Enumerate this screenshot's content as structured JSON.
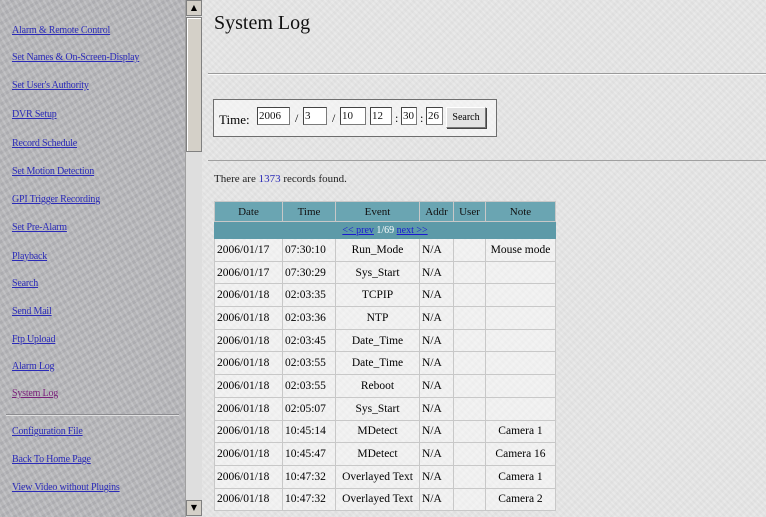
{
  "sidebar": {
    "items": [
      {
        "label": "Alarm & Remote Control",
        "visited": false
      },
      {
        "label": "Set Names & On-Screen-Display",
        "visited": false
      },
      {
        "label": "Set User's Authority",
        "visited": false
      },
      {
        "label": "DVR Setup",
        "visited": false
      },
      {
        "label": "Record Schedule",
        "visited": false
      },
      {
        "label": "Set Motion Detection",
        "visited": false
      },
      {
        "label": "GPI Trigger Recording",
        "visited": false
      },
      {
        "label": "Set Pre-Alarm",
        "visited": false
      },
      {
        "label": "Playback",
        "visited": false
      },
      {
        "label": "Search",
        "visited": false
      },
      {
        "label": "Send Mail",
        "visited": false
      },
      {
        "label": "Ftp Upload",
        "visited": false
      },
      {
        "label": "Alarm Log",
        "visited": false
      },
      {
        "label": "System Log",
        "visited": true
      }
    ],
    "bottom_items": [
      {
        "label": "Configuration File"
      },
      {
        "label": "Back To Home Page"
      },
      {
        "label": "View Video without Plugins"
      }
    ]
  },
  "page": {
    "title": "System Log"
  },
  "time_filter": {
    "label": "Time:",
    "year": "2006",
    "month": "3",
    "day": "10",
    "hour": "12",
    "minute": "30",
    "second": "26",
    "sep_slash": "/",
    "sep_colon": ":",
    "search_label": "Search"
  },
  "records": {
    "prefix": "There are",
    "count": "1373",
    "suffix": "records found."
  },
  "table": {
    "pager": {
      "prev_label": "<< prev",
      "page_info": "1/69",
      "next_label": "next >>"
    },
    "columns": [
      "Date",
      "Time",
      "Event",
      "Addr",
      "User",
      "Note"
    ],
    "rows": [
      {
        "date": "2006/01/17",
        "time": "07:30:10",
        "event": "Run_Mode",
        "addr": "N/A",
        "user": "",
        "note": "Mouse mode"
      },
      {
        "date": "2006/01/17",
        "time": "07:30:29",
        "event": "Sys_Start",
        "addr": "N/A",
        "user": "",
        "note": ""
      },
      {
        "date": "2006/01/18",
        "time": "02:03:35",
        "event": "TCPIP",
        "addr": "N/A",
        "user": "",
        "note": ""
      },
      {
        "date": "2006/01/18",
        "time": "02:03:36",
        "event": "NTP",
        "addr": "N/A",
        "user": "",
        "note": ""
      },
      {
        "date": "2006/01/18",
        "time": "02:03:45",
        "event": "Date_Time",
        "addr": "N/A",
        "user": "",
        "note": ""
      },
      {
        "date": "2006/01/18",
        "time": "02:03:55",
        "event": "Date_Time",
        "addr": "N/A",
        "user": "",
        "note": ""
      },
      {
        "date": "2006/01/18",
        "time": "02:03:55",
        "event": "Reboot",
        "addr": "N/A",
        "user": "",
        "note": ""
      },
      {
        "date": "2006/01/18",
        "time": "02:05:07",
        "event": "Sys_Start",
        "addr": "N/A",
        "user": "",
        "note": ""
      },
      {
        "date": "2006/01/18",
        "time": "10:45:14",
        "event": "MDetect",
        "addr": "N/A",
        "user": "",
        "note": "Camera 1"
      },
      {
        "date": "2006/01/18",
        "time": "10:45:47",
        "event": "MDetect",
        "addr": "N/A",
        "user": "",
        "note": "Camera 16"
      },
      {
        "date": "2006/01/18",
        "time": "10:47:32",
        "event": "Overlayed Text",
        "addr": "N/A",
        "user": "",
        "note": "Camera 1"
      },
      {
        "date": "2006/01/18",
        "time": "10:47:32",
        "event": "Overlayed Text",
        "addr": "N/A",
        "user": "",
        "note": "Camera 2"
      }
    ]
  },
  "scrollbar": {
    "up_icon": "arrow-up-icon",
    "down_icon": "arrow-down-icon"
  }
}
